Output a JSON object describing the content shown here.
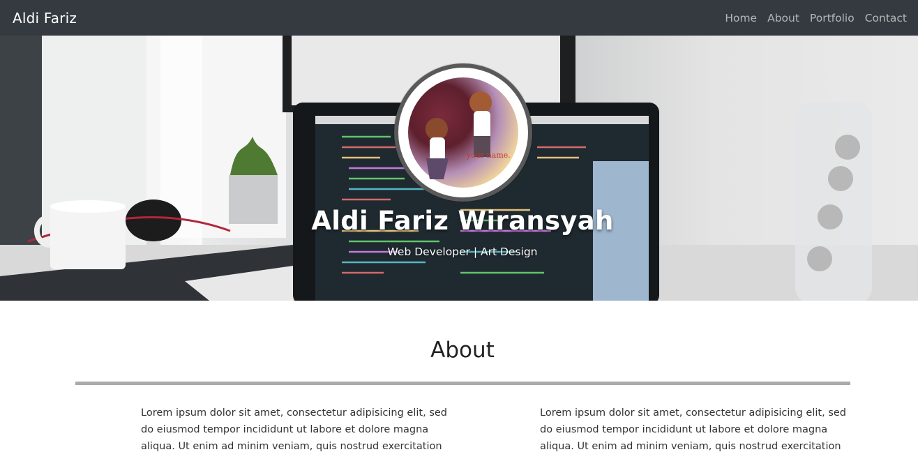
{
  "navbar": {
    "brand": "Aldi Fariz",
    "links": [
      "Home",
      "About",
      "Portfolio",
      "Contact"
    ]
  },
  "hero": {
    "name": "Aldi Fariz Wiransyah",
    "subtitle": "Web Developer | Art Design",
    "avatar_caption": "your name."
  },
  "about": {
    "title": "About",
    "paragraphs": [
      "Lorem ipsum dolor sit amet, consectetur adipisicing elit, sed do eiusmod tempor incididunt ut labore et dolore magna aliqua. Ut enim ad minim veniam, quis nostrud exercitation",
      "Lorem ipsum dolor sit amet, consectetur adipisicing elit, sed do eiusmod tempor incididunt ut labore et dolore magna aliqua. Ut enim ad minim veniam, quis nostrud exercitation"
    ]
  },
  "colors": {
    "navbar_bg": "#343a40",
    "divider": "#aaaaaa"
  }
}
